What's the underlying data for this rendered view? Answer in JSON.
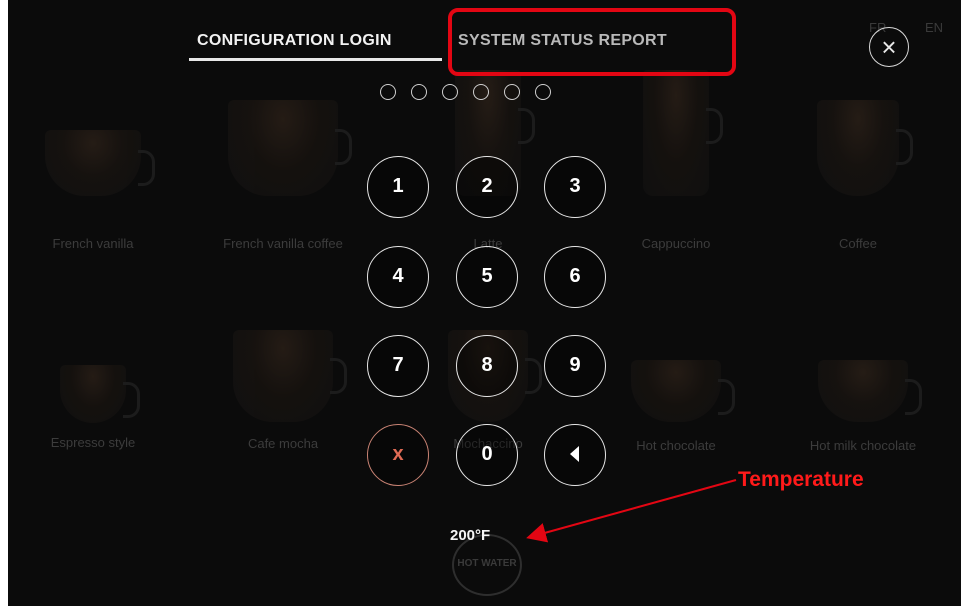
{
  "tabs": {
    "config_login": "CONFIGURATION LOGIN",
    "system_status_report": "SYSTEM STATUS REPORT"
  },
  "languages": [
    "FR",
    "EN"
  ],
  "close_icon": "×",
  "pin_dots_count": 6,
  "keypad": {
    "k1": "1",
    "k2": "2",
    "k3": "3",
    "k4": "4",
    "k5": "5",
    "k6": "6",
    "k7": "7",
    "k8": "8",
    "k9": "9",
    "clear": "x",
    "k0": "0",
    "back_icon": "left-triangle-icon"
  },
  "temperature": "200°F",
  "hot_water_label": "HOT WATER",
  "drinks": {
    "row1": [
      "French vanilla",
      "French vanilla coffee",
      "Latte",
      "Cappuccino",
      "Coffee"
    ],
    "row2": [
      "Espresso style",
      "Cafe mocha",
      "Mochaccino",
      "Hot chocolate",
      "Hot milk chocolate"
    ]
  },
  "annotation": {
    "label": "Temperature",
    "color": "#e30613"
  }
}
